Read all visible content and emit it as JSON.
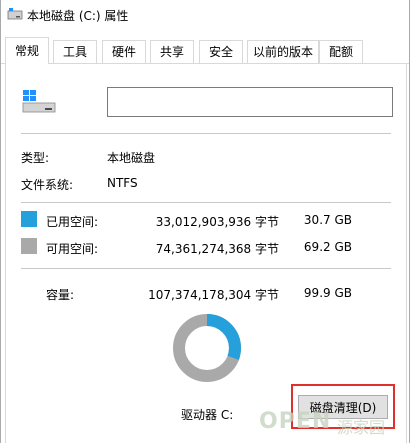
{
  "window": {
    "title": "本地磁盘 (C:) 属性"
  },
  "tabs": [
    {
      "label": "常规",
      "active": true
    },
    {
      "label": "工具"
    },
    {
      "label": "硬件"
    },
    {
      "label": "共享"
    },
    {
      "label": "安全"
    },
    {
      "label": "以前的版本"
    },
    {
      "label": "配额"
    }
  ],
  "general": {
    "name_value": "",
    "type_label": "类型:",
    "type_value": "本地磁盘",
    "fs_label": "文件系统:",
    "fs_value": "NTFS",
    "used": {
      "label": "已用空间:",
      "bytes": "33,012,903,936 字节",
      "size": "30.7 GB",
      "color": "#26a0da"
    },
    "free": {
      "label": "可用空间:",
      "bytes": "74,361,274,368 字节",
      "size": "69.2 GB",
      "color": "#a9a9a9"
    },
    "capacity": {
      "label": "容量:",
      "bytes": "107,374,178,304 字节",
      "size": "99.9 GB"
    },
    "drive_label": "驱动器 C:",
    "cleanup_button": "磁盘清理(D)",
    "used_fraction": 0.307
  },
  "watermark": {
    "text": "OPEN",
    "text2": "源家园"
  }
}
